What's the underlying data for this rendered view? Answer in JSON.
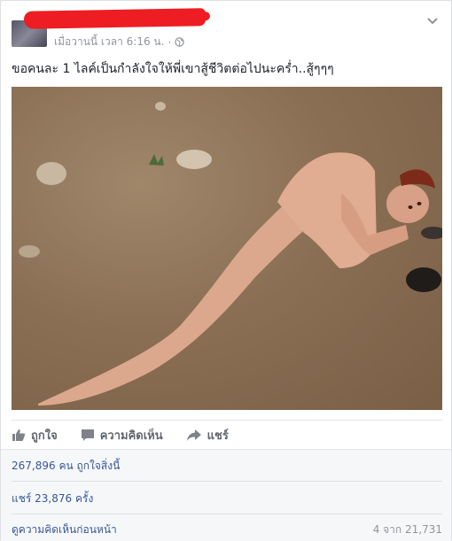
{
  "post": {
    "meta_time": "เมื่อวานนี้ เวลา 6:16 น.",
    "meta_separator": "·",
    "text": "ขอคนละ 1 ไลค์เป็นกำลังใจให้พี่เขาสู้ชีวิตต่อไปนะคร่ำ..สู้ๆๆๆ"
  },
  "actions": {
    "like_label": "ถูกใจ",
    "comment_label": "ความคิดเห็น",
    "share_label": "แชร์"
  },
  "stats": {
    "likes_count": "267,896",
    "likes_suffix": "คน ถูกใจสิ่งนี้",
    "shares_prefix": "แชร์",
    "shares_count": "23,876",
    "shares_suffix": "ครั้ง",
    "view_previous_comments": "ดูความคิดเห็นก่อนหน้า",
    "comments_count": "4 จาก 21,731"
  },
  "colors": {
    "link": "#365899",
    "muted": "#90949c",
    "redaction": "#ee1d23"
  }
}
